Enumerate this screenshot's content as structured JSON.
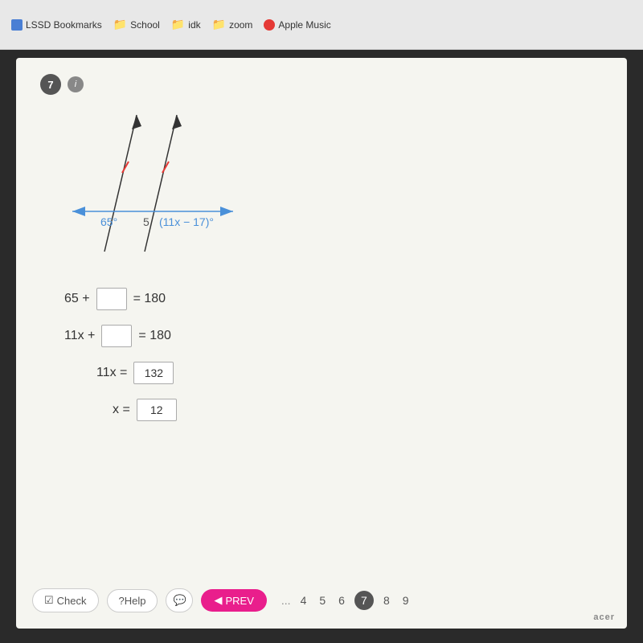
{
  "browser": {
    "bookmarks": [
      {
        "label": "LSSD Bookmarks",
        "icon_type": "blue"
      },
      {
        "label": "School",
        "icon_type": "folder"
      },
      {
        "label": "idk",
        "icon_type": "folder"
      },
      {
        "label": "zoom",
        "icon_type": "folder"
      },
      {
        "label": "Apple Music",
        "icon_type": "apple"
      }
    ]
  },
  "question": {
    "number": "7",
    "info_label": "i",
    "diagram": {
      "angle1": "65°",
      "angle_num": "5",
      "angle2_expr": "(11x − 17)°"
    },
    "equations": [
      {
        "left": "65 + ",
        "box": "",
        "right": " = 180"
      },
      {
        "left": "11x + ",
        "box": "",
        "right": " = 180"
      },
      {
        "left": "11x = ",
        "box_value": "132",
        "right": ""
      },
      {
        "left": "x = ",
        "box_value": "12",
        "right": ""
      }
    ]
  },
  "toolbar": {
    "check_label": "Check",
    "help_label": "?Help",
    "chat_icon": "💬",
    "prev_label": "PREV",
    "pages": [
      "...",
      "4",
      "5",
      "6",
      "7",
      "8",
      "9"
    ]
  },
  "footer": {
    "brand": "acer"
  }
}
